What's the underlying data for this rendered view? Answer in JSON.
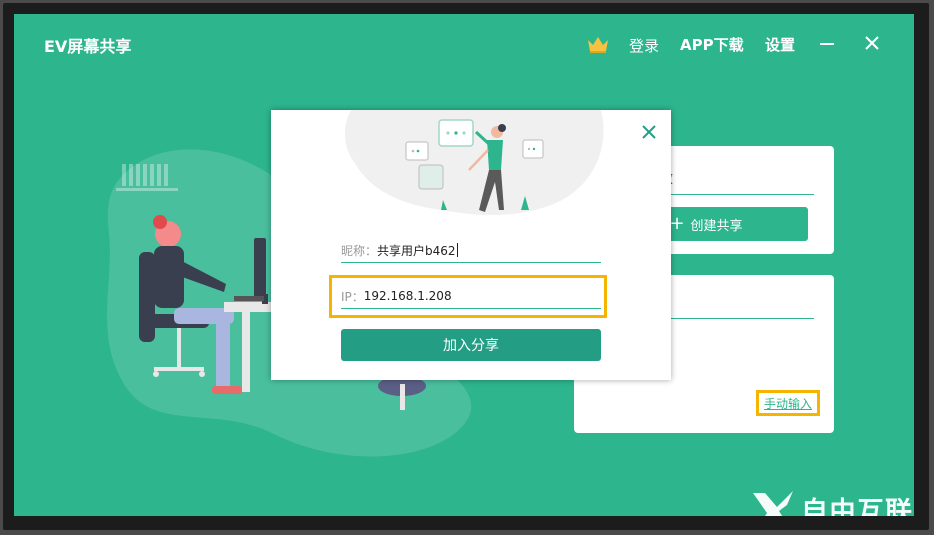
{
  "app": {
    "title": "EV屏幕共享"
  },
  "nav": {
    "login": "登录",
    "app_download": "APP下载",
    "settings": "设置"
  },
  "icons": {
    "crown": "crown-icon",
    "minimize": "minimize-icon",
    "close": "close-icon",
    "dialog_close": "close-icon",
    "plus": "plus-icon"
  },
  "colors": {
    "primary": "#2db58e",
    "highlight": "#f5b400",
    "button": "#239e85"
  },
  "create_card": {
    "partial_text": "效",
    "create_button": "创建共享"
  },
  "join_card": {
    "manual_input": "手动输入"
  },
  "dialog": {
    "nickname_label": "昵称：",
    "nickname_value": "共享用户b462",
    "ip_label": "IP：",
    "ip_value": "192.168.1.208",
    "join_button": "加入分享"
  },
  "watermark": {
    "text": "自由互联"
  }
}
